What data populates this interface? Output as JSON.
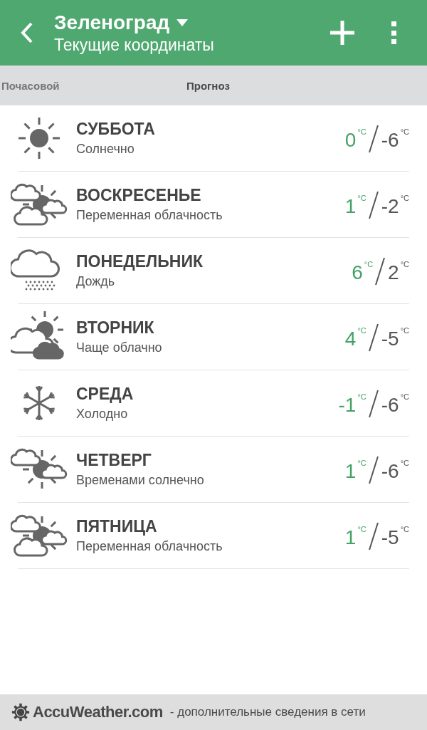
{
  "header": {
    "title": "Зеленоград",
    "subtitle": "Текущие координаты"
  },
  "tabs": [
    {
      "label": "Почасовой",
      "selected": false
    },
    {
      "label": "Прогноз",
      "selected": true
    }
  ],
  "days": [
    {
      "name": "СУББОТА",
      "condition": "Солнечно",
      "kind": "sunny",
      "high": "0",
      "high_unit": "°C",
      "low": "-6",
      "low_unit": "°C"
    },
    {
      "name": "ВОСКРЕСЕНЬЕ",
      "condition": "Переменная облачность",
      "kind": "partly",
      "high": "1",
      "high_unit": "°C",
      "low": "-2",
      "low_unit": "°C"
    },
    {
      "name": "ПОНЕДЕЛЬНИК",
      "condition": "Дождь",
      "kind": "rain",
      "high": "6",
      "high_unit": "°C",
      "low": "2",
      "low_unit": "°C"
    },
    {
      "name": "ВТОРНИК",
      "condition": "Чаще облачно",
      "kind": "cloudy",
      "high": "4",
      "high_unit": "°C",
      "low": "-5",
      "low_unit": "°C"
    },
    {
      "name": "СРЕДА",
      "condition": "Холодно",
      "kind": "cold",
      "high": "-1",
      "high_unit": "°C",
      "low": "-6",
      "low_unit": "°C"
    },
    {
      "name": "ЧЕТВЕРГ",
      "condition": "Временами солнечно",
      "kind": "intermittent",
      "high": "1",
      "high_unit": "°C",
      "low": "-6",
      "low_unit": "°C"
    },
    {
      "name": "ПЯТНИЦА",
      "condition": "Переменная облачность",
      "kind": "partly",
      "high": "1",
      "high_unit": "°C",
      "low": "-5",
      "low_unit": "°C"
    }
  ],
  "footer": {
    "brand": "AccuWeather.com",
    "note": "- дополнительные сведения в сети"
  }
}
